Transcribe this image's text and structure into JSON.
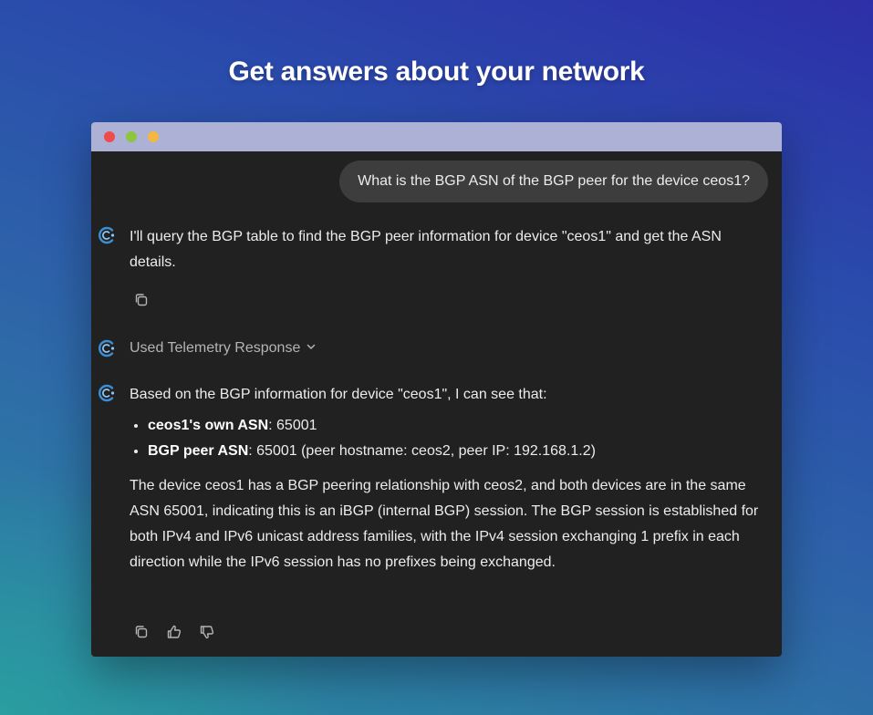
{
  "headline": "Get answers about your network",
  "window": {
    "controls": {
      "close_color": "#ef4b4b",
      "minimize_color": "#8cc63e",
      "maximize_color": "#f4b740"
    }
  },
  "chat": {
    "user_message": "What is the BGP ASN of the BGP peer for the device ceos1?",
    "assistant_intro": "I'll query the BGP table to find the BGP peer information for device \"ceos1\" and get the ASN details.",
    "tool_label": "Used Telemetry Response",
    "answer_intro": "Based on the BGP information for device \"ceos1\", I can see that:",
    "facts": [
      {
        "label": "ceos1's own ASN",
        "value": ": 65001"
      },
      {
        "label": "BGP peer ASN",
        "value": ": 65001 (peer hostname: ceos2, peer IP: 192.168.1.2)"
      }
    ],
    "answer_paragraph": "The device ceos1 has a BGP peering relationship with ceos2, and both devices are in the same ASN 65001, indicating this is an iBGP (internal BGP) session. The BGP session is established for both IPv4 and IPv6 unicast address families, with the IPv4 session exchanging 1 prefix in each direction while the IPv6 session has no prefixes being exchanged.",
    "icons": {
      "assistant_avatar": "assistant-logo-icon",
      "copy": "copy-icon",
      "thumbs_up": "thumbs-up-icon",
      "thumbs_down": "thumbs-down-icon",
      "chevron": "chevron-down-icon"
    }
  },
  "colors": {
    "window_bg": "#212121",
    "bubble_bg": "#3d3d3d",
    "titlebar": "#aeb1d6",
    "avatar_accent": "#3a8fd8"
  }
}
